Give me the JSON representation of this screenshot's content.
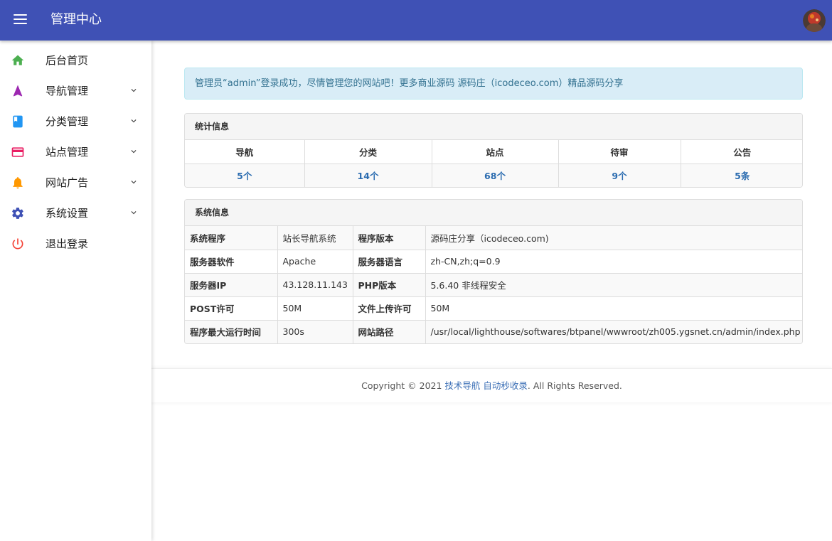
{
  "header": {
    "title": "管理中心"
  },
  "sidebar": {
    "items": [
      {
        "label": "后台首页",
        "icon": "home-icon",
        "color": "#4caf50",
        "has_submenu": false
      },
      {
        "label": "导航管理",
        "icon": "navigation-arrow-icon",
        "color": "#9c27b0",
        "has_submenu": true
      },
      {
        "label": "分类管理",
        "icon": "book-icon",
        "color": "#2196f3",
        "has_submenu": true
      },
      {
        "label": "站点管理",
        "icon": "browser-window-icon",
        "color": "#e91e63",
        "has_submenu": true
      },
      {
        "label": "网站广告",
        "icon": "bell-icon",
        "color": "#ff9800",
        "has_submenu": true
      },
      {
        "label": "系统设置",
        "icon": "gear-icon",
        "color": "#3f51b5",
        "has_submenu": true
      },
      {
        "label": "退出登录",
        "icon": "power-icon",
        "color": "#f44336",
        "has_submenu": false
      }
    ]
  },
  "alert": {
    "text": "管理员“admin”登录成功，尽情管理您的网站吧！更多商业源码 源码庄（icodeceo.com）精品源码分享"
  },
  "stats": {
    "title": "统计信息",
    "headers": [
      "导航",
      "分类",
      "站点",
      "待审",
      "公告"
    ],
    "values": [
      "5个",
      "14个",
      "68个",
      "9个",
      "5条"
    ]
  },
  "sysinfo": {
    "title": "系统信息",
    "rows": [
      {
        "k1": "系统程序",
        "v1": "站长导航系统",
        "k2": "程序版本",
        "v2": "源码庄分享（icodeceo.com)"
      },
      {
        "k1": "服务器软件",
        "v1": "Apache",
        "k2": "服务器语言",
        "v2": "zh-CN,zh;q=0.9"
      },
      {
        "k1": "服务器IP",
        "v1": "43.128.11.143",
        "k2": "PHP版本",
        "v2": "5.6.40 非线程安全"
      },
      {
        "k1": "POST许可",
        "v1": "50M",
        "k2": "文件上传许可",
        "v2": "50M"
      },
      {
        "k1": "程序最大运行时间",
        "v1": "300s",
        "k2": "网站路径",
        "v2": "/usr/local/lighthouse/softwares/btpanel/wwwroot/zh005.ygsnet.cn/admin/index.php"
      }
    ]
  },
  "footer": {
    "prefix": "Copyright © 2021 ",
    "link1": "技术导航",
    "link2": "自动秒收录",
    "suffix": ". All Rights Reserved."
  }
}
